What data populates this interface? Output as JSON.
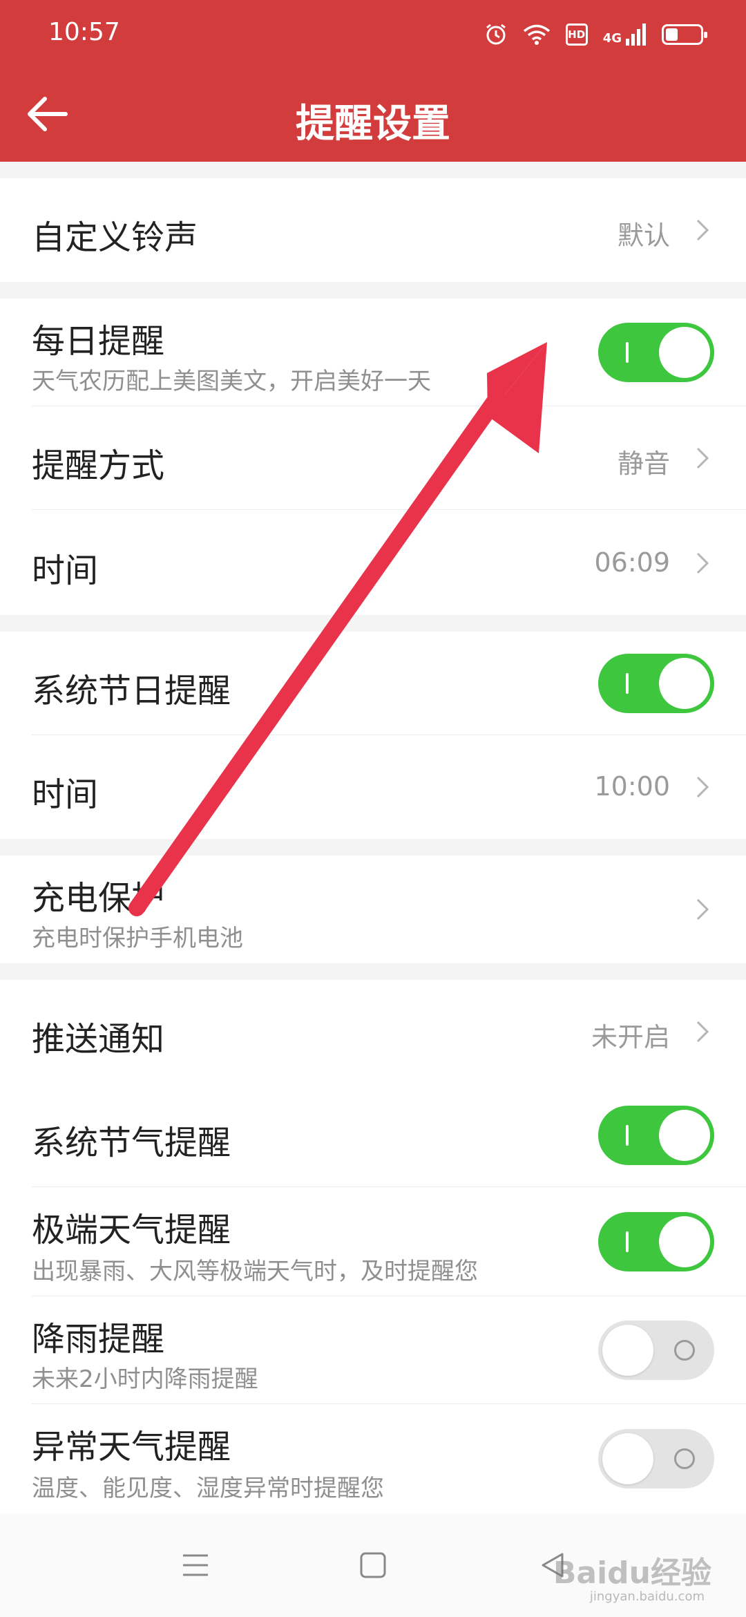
{
  "status_bar": {
    "time": "10:57",
    "network": "4G",
    "hd": "HD",
    "battery_level": 0.35
  },
  "header": {
    "title": "提醒设置",
    "back_icon": "back-arrow-icon",
    "background": "#d33c3c"
  },
  "rows": {
    "custom_ringtone": {
      "label": "自定义铃声",
      "value": "默认"
    },
    "daily_reminder": {
      "label": "每日提醒",
      "subtitle": "天气农历配上美图美文，开启美好一天",
      "enabled": true
    },
    "reminder_method": {
      "label": "提醒方式",
      "value": "静音"
    },
    "daily_time": {
      "label": "时间",
      "value": "06:09"
    },
    "holiday_reminder": {
      "label": "系统节日提醒",
      "enabled": true
    },
    "holiday_time": {
      "label": "时间",
      "value": "10:00"
    },
    "charging_protection": {
      "label": "充电保护",
      "subtitle": "充电时保护手机电池"
    },
    "push_notification": {
      "label": "推送通知",
      "value": "未开启"
    },
    "solar_term_reminder": {
      "label": "系统节气提醒",
      "enabled": true
    },
    "extreme_weather": {
      "label": "极端天气提醒",
      "subtitle": "出现暴雨、大风等极端天气时，及时提醒您",
      "enabled": true
    },
    "rain_reminder": {
      "label": "降雨提醒",
      "subtitle": "未来2小时内降雨提醒",
      "enabled": false
    },
    "abnormal_weather": {
      "label": "异常天气提醒",
      "subtitle": "温度、能见度、湿度异常时提醒您",
      "enabled": false
    }
  },
  "colors": {
    "toggle_on": "#3ec73e",
    "toggle_off": "#e3e3e3",
    "annotation_arrow": "#e8334a"
  },
  "nav_bar": {
    "menu_icon": "menu-icon",
    "home_icon": "home-square-icon",
    "back_icon": "back-triangle-icon"
  },
  "watermark": {
    "brand": "Baidu经验",
    "url": "jingyan.baidu.com"
  }
}
